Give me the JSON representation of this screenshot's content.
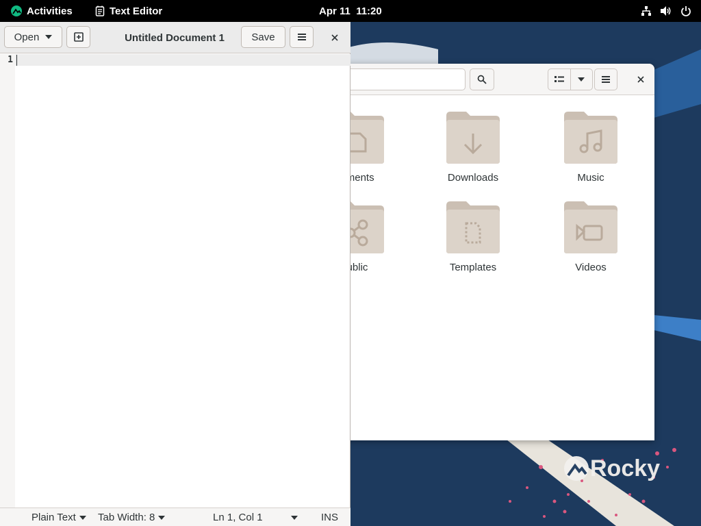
{
  "topbar": {
    "activities": "Activities",
    "app_name": "Text Editor",
    "clock": "Apr 11  11:20",
    "icons": [
      "network-icon",
      "volume-icon",
      "power-icon"
    ]
  },
  "editor": {
    "open_label": "Open",
    "title": "Untitled Document 1",
    "save_label": "Save",
    "line_number": "1",
    "status": {
      "language": "Plain Text",
      "tab_width": "Tab Width: 8",
      "position": "Ln 1, Col 1",
      "mode": "INS"
    }
  },
  "files": {
    "folders": [
      {
        "label": "Documents",
        "visible_label": "uments",
        "icon": "document-folder-icon"
      },
      {
        "label": "Downloads",
        "visible_label": "Downloads",
        "icon": "download-folder-icon"
      },
      {
        "label": "Music",
        "visible_label": "Music",
        "icon": "music-folder-icon"
      },
      {
        "label": "Public",
        "visible_label": "ublic",
        "icon": "share-folder-icon"
      },
      {
        "label": "Templates",
        "visible_label": "Templates",
        "icon": "template-folder-icon"
      },
      {
        "label": "Videos",
        "visible_label": "Videos",
        "icon": "video-folder-icon"
      }
    ]
  },
  "wallpaper": {
    "brand": "Rocky",
    "colors": {
      "background": "#1d3a5e",
      "accent": "#10b981",
      "folder": "#dcd3c9",
      "folder_tab": "#cbbfb3"
    }
  }
}
